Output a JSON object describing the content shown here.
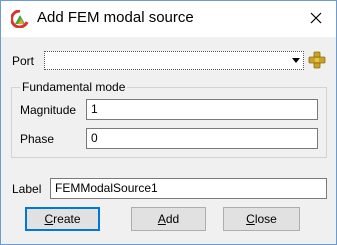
{
  "window": {
    "title": "Add FEM modal source",
    "icons": {
      "app": "app-logo-icon",
      "close": "close-icon"
    }
  },
  "port": {
    "label": "Port",
    "selected_value": "",
    "add_icon": "add-port-icon"
  },
  "fundamental_mode": {
    "title": "Fundamental mode",
    "magnitude_label": "Magnitude",
    "magnitude_value": "1",
    "phase_label": "Phase",
    "phase_value": "0"
  },
  "label_field": {
    "label": "Label",
    "value": "FEMModalSource1"
  },
  "buttons": {
    "create_mnemonic": "C",
    "create_rest": "reate",
    "add_mnemonic": "A",
    "add_rest": "dd",
    "close_mnemonic": "C",
    "close_rest": "lose"
  },
  "colors": {
    "default_button_border": "#0078d7",
    "window_border": "#6b9bd1"
  }
}
